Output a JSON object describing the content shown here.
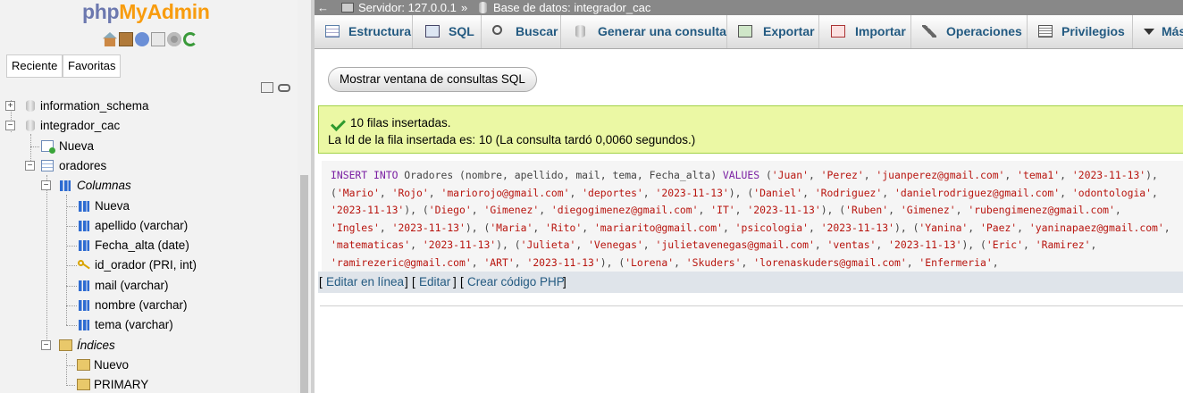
{
  "nav": {
    "logo_php": "php",
    "logo_admin": "MyAdmin",
    "quick_icons": [
      "home-icon",
      "exit-icon",
      "help-icon",
      "docs-icon",
      "settings-icon",
      "reload-icon"
    ],
    "tab_recent": "Reciente",
    "tab_favorites": "Favoritas",
    "tree": {
      "db1": "information_schema",
      "db2": "integrador_cac",
      "new_table": "Nueva",
      "table": "oradores",
      "columns_group": "Columnas",
      "columns_new": "Nueva",
      "columns": [
        "apellido (varchar)",
        "Fecha_alta (date)",
        "id_orador (PRI, int)",
        "mail (varchar)",
        "nombre (varchar)",
        "tema (varchar)"
      ],
      "indexes_group": "Índices",
      "indexes_new": "Nuevo",
      "indexes": [
        "PRIMARY"
      ]
    }
  },
  "topbar": {
    "back": "←",
    "server": "Servidor: 127.0.0.1",
    "separator": "»",
    "database": "Base de datos: integrador_cac"
  },
  "menu": {
    "structure": "Estructura",
    "sql": "SQL",
    "search": "Buscar",
    "query": "Generar una consulta",
    "export": "Exportar",
    "import": "Importar",
    "operations": "Operaciones",
    "privileges": "Privilegios",
    "more": "Más"
  },
  "content": {
    "show_sql_window": "Mostrar ventana de consultas SQL",
    "success_line1": "10 filas insertadas.",
    "success_line2": "La Id de la fila insertada es: 10 (La consulta tardó 0,0060 segundos.)",
    "sql_kw_insert": "INSERT",
    "sql_kw_into": "INTO",
    "sql_head": " Oradores (nombre, apellido, mail, tema, Fecha_alta) ",
    "sql_kw_values": "VALUES",
    "sql_rows": [
      [
        "'Juan'",
        "'Perez'",
        "'juanperez@gmail.com'",
        "'tema1'",
        "'2023-11-13'"
      ],
      [
        "'Mario'",
        "'Rojo'",
        "'mariorojo@gmail.com'",
        "'deportes'",
        "'2023-11-13'"
      ],
      [
        "'Daniel'",
        "'Rodriguez'",
        "'danielrodriguez@gmail.com'",
        "'odontologia'",
        "'2023-11-13'"
      ],
      [
        "'Diego'",
        "'Gimenez'",
        "'diegogimenez@gmail.com'",
        "'IT'",
        "'2023-11-13'"
      ],
      [
        "'Ruben'",
        "'Gimenez'",
        "'rubengimenez@gmail.com'",
        "'Ingles'",
        "'2023-11-13'"
      ],
      [
        "'Maria'",
        "'Rito'",
        "'mariarito@gmail.com'",
        "'psicologia'",
        "'2023-11-13'"
      ],
      [
        "'Yanina'",
        "'Paez'",
        "'yaninapaez@gmail.com'",
        "'matematicas'",
        "'2023-11-13'"
      ],
      [
        "'Julieta'",
        "'Venegas'",
        "'julietavenegas@gmail.com'",
        "'ventas'",
        "'2023-11-13'"
      ],
      [
        "'Eric'",
        "'Ramirez'",
        "'ramirezeric@gmail.com'",
        "'ART'",
        "'2023-11-13'"
      ],
      [
        "'Lorena'",
        "'Skuders'",
        "'lorenaskuders@gmail.com'",
        "'Enfermeria'"
      ]
    ],
    "link_edit_inline": "Editar en línea",
    "link_edit": "Editar",
    "link_php": "Crear código PHP",
    "bracket_open": "[",
    "bracket_close": "]"
  },
  "colors": {
    "link": "#235a81",
    "success_bg": "#ebf8a4",
    "sql_keyword": "#7a1fa2",
    "sql_string": "#b8150f",
    "logo_php": "#6c78af",
    "logo_admin": "#f89c0e"
  }
}
